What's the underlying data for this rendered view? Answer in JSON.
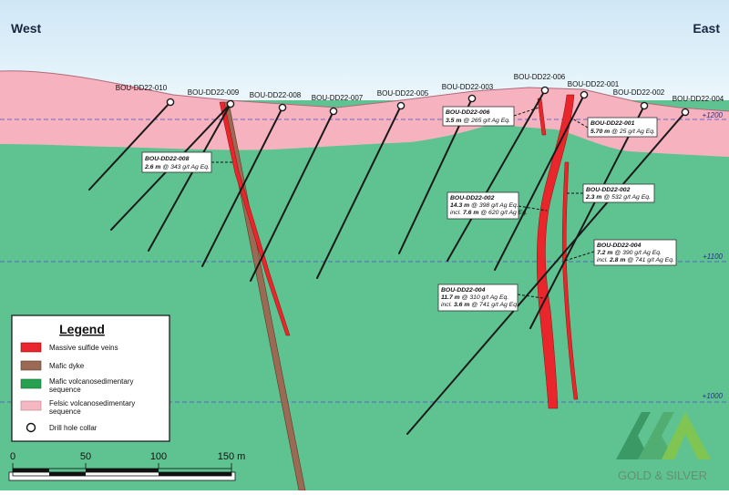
{
  "directions": {
    "west": "West",
    "east": "East"
  },
  "elevations": [
    "+1200",
    "+1100",
    "+1000"
  ],
  "collars": [
    "BOU-DD22-010",
    "BOU-DD22-009",
    "BOU-DD22-008",
    "BOU-DD22-007",
    "BOU-DD22-005",
    "BOU-DD22-003",
    "BOU-DD22-006",
    "BOU-DD22-001",
    "BOU-DD22-002",
    "BOU-DD22-004"
  ],
  "intercepts": [
    {
      "hole": "BOU-DD22-008",
      "lines": [
        {
          "len": "2.6 m",
          "grade": " @ 343 g/t Ag Eq."
        }
      ]
    },
    {
      "hole": "BOU-DD22-006",
      "lines": [
        {
          "len": "3.5 m",
          "grade": " @ 265 g/t Ag Eq."
        }
      ]
    },
    {
      "hole": "BOU-DD22-001",
      "lines": [
        {
          "len": "5.70 m",
          "grade": " @ 25 g/t Ag Eq."
        }
      ]
    },
    {
      "hole": "BOU-DD22-002",
      "lines": [
        {
          "len": "14.3 m",
          "grade": " @ 398 g/t Ag Eq."
        },
        {
          "pre": "incl. ",
          "len": "7.6 m",
          "grade": " @ 620 g/t Ag Eq."
        }
      ]
    },
    {
      "hole": "BOU-DD22-002",
      "lines": [
        {
          "len": "2.3 m",
          "grade": " @ 532 g/t Ag Eq."
        }
      ]
    },
    {
      "hole": "BOU-DD22-004",
      "lines": [
        {
          "len": "7.2 m",
          "grade": " @ 390 g/t Ag Eq."
        },
        {
          "pre": "incl. ",
          "len": "2.8 m",
          "grade": " @ 741 g/t Ag Eq."
        }
      ]
    },
    {
      "hole": "BOU-DD22-004",
      "lines": [
        {
          "len": "11.7 m",
          "grade": " @ 310 g/t Ag Eq."
        },
        {
          "pre": "incl. ",
          "len": "3.6 m",
          "grade": " @ 741 g/t Ag Eq."
        }
      ]
    }
  ],
  "legend": {
    "title": "Legend",
    "items": [
      {
        "label": "Massive sulfide veins",
        "color": "#e8262b"
      },
      {
        "label": "Mafic dyke",
        "color": "#9a6a55"
      },
      {
        "label": "Mafic volcanosedimentary sequence",
        "color": "#27a04f"
      },
      {
        "label": "Felsic volcanosedimentary sequence",
        "color": "#f5b8c2"
      },
      {
        "label": "Drill hole collar",
        "color": "#ffffff"
      }
    ]
  },
  "scale_bar": {
    "ticks": [
      "0",
      "50",
      "100",
      "150 m"
    ]
  },
  "logo": {
    "text": "GOLD & SILVER"
  },
  "colors": {
    "mafic": "#5ec391",
    "felsic": "#f6b3bf",
    "sky_top": "#cde6f6",
    "sky_bottom": "#eaf6fc",
    "vein": "#e8262b",
    "dyke": "#9a6a55",
    "elev_line": "#4a4fb8"
  }
}
